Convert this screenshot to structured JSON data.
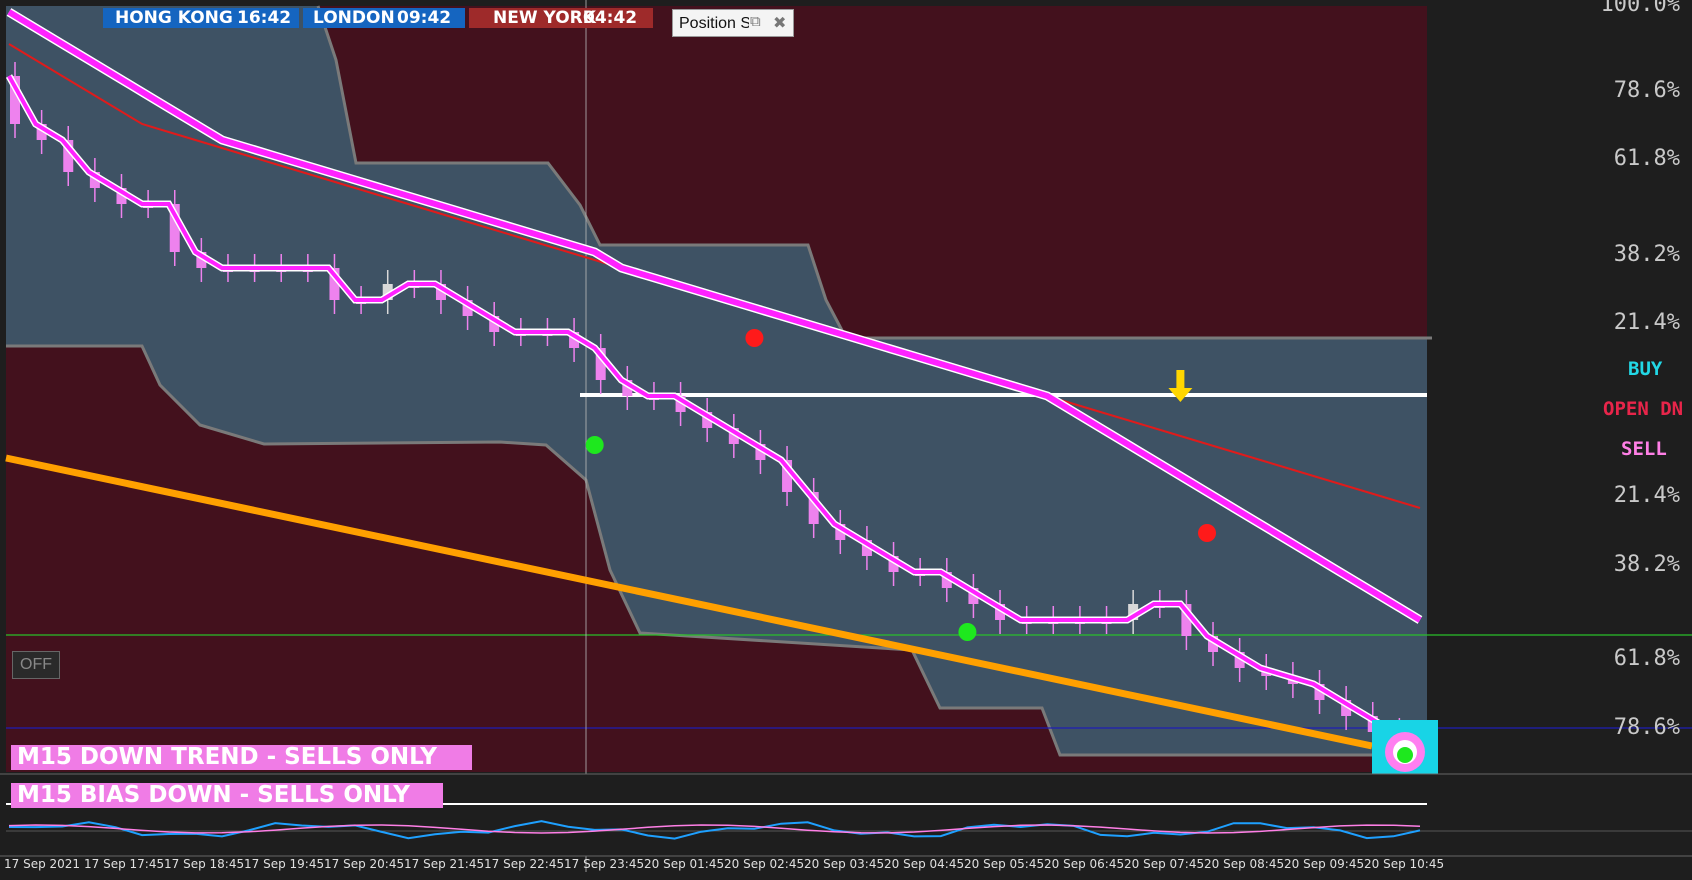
{
  "clocks": [
    {
      "place": "HONG KONG",
      "time": "16:42",
      "bg": "#1565c0"
    },
    {
      "place": "LONDON",
      "time": "09:42",
      "bg": "#1565c0"
    },
    {
      "place": "NEW YORK",
      "time": "04:42",
      "bg": "#9e2a2a"
    }
  ],
  "position_panel": {
    "label": "Position Size",
    "restore_icon": "restore-icon",
    "close_icon": "close-icon"
  },
  "off_button": "OFF",
  "banners": [
    "M15  DOWN TREND - SELLS ONLY",
    "M15  BIAS DOWN - SELLS ONLY"
  ],
  "side_labels": [
    {
      "text": "BUY",
      "color": "#22d8e6"
    },
    {
      "text": "OPEN DN",
      "color": "#e8254a"
    },
    {
      "text": "SELL",
      "color": "#ff7fe6"
    }
  ],
  "fib_levels": [
    "100.0%",
    "78.6%",
    "61.8%",
    "38.2%",
    "21.4%",
    "21.4%",
    "38.2%",
    "61.8%",
    "78.6%"
  ],
  "colors": {
    "background": "#1e1e1e",
    "zone_bear": "#43111d",
    "zone_band": "#3e5264",
    "bull_candle": "#d9d9d9",
    "bear_candle": "#ee82ee",
    "ma_main": "#ff22ff",
    "ma_bull": "#0018ff",
    "ma_slow": "#e01b1b",
    "channel": "#ffa000",
    "support": "#ffffff",
    "green_line": "#2ac02a",
    "blue_line": "#1e1eb4"
  },
  "chart_data": {
    "type": "line",
    "title": "",
    "xlabel": "",
    "ylabel": "",
    "x_tick_labels": [
      "17 Sep 2021",
      "17 Sep 17:45",
      "17 Sep 18:45",
      "17 Sep 19:45",
      "17 Sep 20:45",
      "17 Sep 21:45",
      "17 Sep 22:45",
      "17 Sep 23:45",
      "20 Sep 01:45",
      "20 Sep 02:45",
      "20 Sep 03:45",
      "20 Sep 04:45",
      "20 Sep 05:45",
      "20 Sep 06:45",
      "20 Sep 07:45",
      "20 Sep 08:45",
      "20 Sep 09:45",
      "20 Sep 10:45"
    ],
    "y_scale_note": "price axis not printed; values as relative level 0-100",
    "ylim": [
      0,
      100
    ],
    "series": [
      {
        "values": [
          96,
          94,
          92,
          90,
          88,
          86,
          84,
          82,
          80,
          79,
          78,
          77,
          76,
          75,
          74,
          73,
          72,
          71,
          70,
          69,
          68,
          67,
          66,
          64,
          63,
          62,
          61,
          60,
          59,
          58,
          57,
          56,
          55,
          54,
          53,
          52,
          51,
          50,
          49,
          48,
          46,
          44,
          42,
          40,
          38,
          36,
          34,
          32,
          30,
          28,
          26,
          24,
          22,
          20
        ]
      },
      {
        "values": [
          88,
          82,
          80,
          76,
          74,
          72,
          72,
          66,
          64,
          64,
          64,
          64,
          64,
          60,
          60,
          62,
          62,
          60,
          58,
          56,
          56,
          56,
          54,
          50,
          48,
          48,
          46,
          44,
          42,
          40,
          36,
          32,
          30,
          28,
          26,
          26,
          24,
          22,
          20,
          20,
          20,
          20,
          20,
          22,
          22,
          18,
          16,
          14,
          13,
          12,
          10,
          8,
          6,
          4
        ]
      },
      {
        "values": [
          92,
          90,
          88,
          86,
          84,
          82,
          81,
          80,
          79,
          78,
          77,
          76,
          75,
          74,
          73,
          72,
          71,
          70,
          69,
          68,
          67,
          66,
          65,
          64,
          63,
          62,
          61,
          60,
          59,
          58,
          57,
          56,
          55,
          54,
          53,
          52,
          51,
          50,
          49,
          48,
          47,
          46,
          45,
          44,
          43,
          42,
          41,
          40,
          39,
          38,
          37,
          36,
          35,
          34
        ]
      }
    ],
    "annotations": [
      "sell arrow",
      "buy dot",
      "buy dot",
      "sell dot",
      "sell dot"
    ]
  }
}
